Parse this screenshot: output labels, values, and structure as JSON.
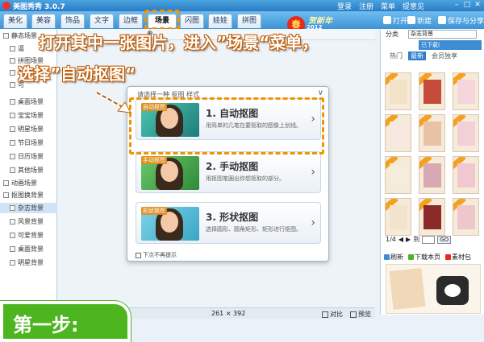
{
  "app": {
    "title": "美图秀秀 3.0.7"
  },
  "top_links": [
    "登录",
    "注册",
    "菜单",
    "提意见"
  ],
  "tabs": [
    "美化",
    "美容",
    "饰品",
    "文字",
    "边框",
    "场景",
    "闪图",
    "娃娃",
    "拼图"
  ],
  "active_tab": "场景",
  "logo": {
    "badge": "春",
    "script": "贺新年",
    "year": "2012"
  },
  "toolbar": {
    "open": "打开",
    "new": "新建",
    "save_share": "保存与分享"
  },
  "left_panel": {
    "items": [
      {
        "label": "静态场景",
        "indent": 0
      },
      {
        "label": "逼",
        "indent": 1
      },
      {
        "label": "拼图场景",
        "indent": 1
      },
      {
        "label": "非",
        "indent": 1
      },
      {
        "label": "可",
        "indent": 1
      },
      {
        "label": "桌面场景",
        "indent": 1
      },
      {
        "label": "宝宝场景",
        "indent": 1
      },
      {
        "label": "明星场景",
        "indent": 1
      },
      {
        "label": "节日场景",
        "indent": 1
      },
      {
        "label": "日历场景",
        "indent": 1
      },
      {
        "label": "其他场景",
        "indent": 1
      },
      {
        "label": "动画场景",
        "indent": 0
      },
      {
        "label": "抠图换背景",
        "indent": 0
      },
      {
        "label": "杂志背景",
        "indent": 1,
        "selected": true
      },
      {
        "label": "风景背景",
        "indent": 1
      },
      {
        "label": "可爱背景",
        "indent": 1
      },
      {
        "label": "桌面背景",
        "indent": 1
      },
      {
        "label": "明星背景",
        "indent": 1
      }
    ]
  },
  "instructions": {
    "line1": "打开其中一张图片，进入”场景“菜单，",
    "line2": "选择”自动抠图“"
  },
  "dialog": {
    "hint": "请选择一种  抠图  样式",
    "close": "∨",
    "options": [
      {
        "tag": "自动抠图",
        "title": "1. 自动抠图",
        "desc": "用简单的几笔在要抠取的图像上划线。"
      },
      {
        "tag": "手动抠图",
        "title": "2. 手动抠图",
        "desc": "用抠图笔圈出你想抠取的部分。"
      },
      {
        "tag": "形状抠图",
        "title": "3. 形状抠图",
        "desc": "选择圆形、圆角矩形、矩形进行抠图。"
      }
    ],
    "checkbox": "下次不再提示"
  },
  "status": {
    "dimensions": "261 × 392",
    "compare": "对比",
    "preview": "预览"
  },
  "right_panel": {
    "category_label": "分类",
    "category_value": "杂志背景",
    "download_note": "已下载(",
    "tabs": [
      "热门",
      "最新",
      "会员独享"
    ],
    "active_tab": "最新",
    "pager": {
      "page": "1/4",
      "prev": "◀",
      "next": "▶",
      "jump_label": "到",
      "go": "GO"
    },
    "actions": [
      "刷新",
      "下载本页",
      "素材包"
    ]
  },
  "step_badge": "第一步:",
  "colors": {
    "accent": "#f29400",
    "step_green": "#4cb51f",
    "title_blue": "#2a7cc4"
  }
}
